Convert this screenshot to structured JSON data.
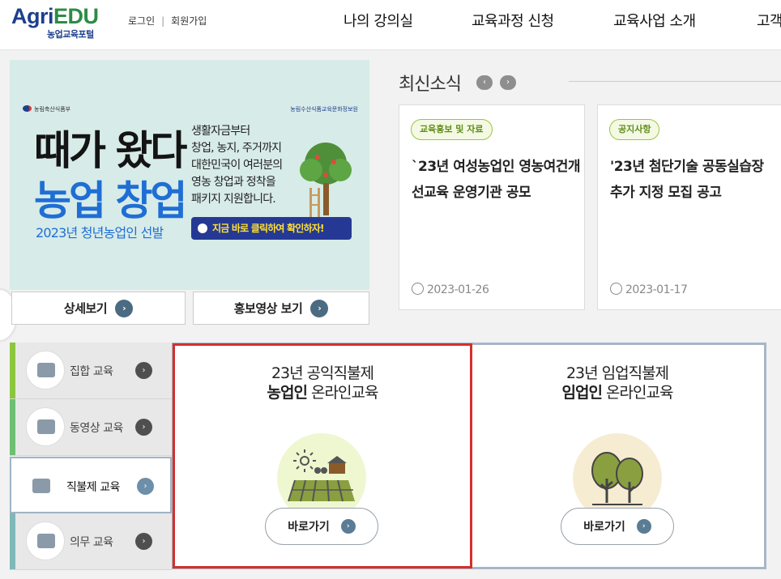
{
  "header": {
    "logo_agri": "Agri",
    "logo_edu": "EDU",
    "logo_sub": "농업교육포털",
    "login": "로그인",
    "separator": "|",
    "signup": "회원가입",
    "nav": [
      "나의 강의실",
      "교육과정 신청",
      "교육사업 소개",
      "고객"
    ]
  },
  "banner": {
    "gov_label": "농림축산식품부",
    "epis_label": "농림수산식품교육문화정보원",
    "headline1": "때가 왔다",
    "headline2": "농업 창업",
    "subtitle": "2023년 청년농업인 선발",
    "copy": "생활자금부터\n창업, 농지, 주거까지\n대한민국이 여러분의\n영농 창업과 정착을\n패키지 지원합니다.",
    "cta": "지금 바로 클릭하여 확인하자!",
    "detail_button": "상세보기",
    "video_button": "홍보영상 보기"
  },
  "news": {
    "title": "최신소식",
    "prev": "‹",
    "next": "›",
    "cards": [
      {
        "tag": "교육홍보 및 자료",
        "title": "`23년 여성농업인 영농여건개선교육 운영기관 공모",
        "date": "2023-01-26"
      },
      {
        "tag": "공지사항",
        "title": "'23년 첨단기술 공동실습장 추가 지정 모집 공고",
        "date": "2023-01-17"
      }
    ]
  },
  "sidebar": {
    "items": [
      {
        "label": "집합 교육",
        "color": "#8cc63f"
      },
      {
        "label": "동영상 교육",
        "color": "#6fbf73"
      },
      {
        "label": "직불제 교육",
        "color": "#6e8faa"
      },
      {
        "label": "의무 교육",
        "color": "#7fb8b8"
      }
    ]
  },
  "programs": [
    {
      "title_line1": "23년 공익직불제",
      "title_bold": "농업인",
      "title_rest": " 온라인교육",
      "button": "바로가기"
    },
    {
      "title_line1": "23년 임업직불제",
      "title_bold": "임업인",
      "title_rest": " 온라인교육",
      "button": "바로가기"
    }
  ],
  "colors": {
    "brand_blue": "#1d3f8c",
    "brand_green": "#2c8c46",
    "highlight": "#d5302c"
  }
}
